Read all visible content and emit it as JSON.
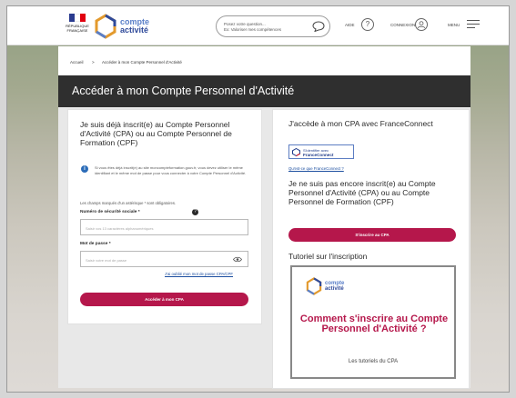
{
  "header": {
    "gov_label": "RÉPUBLIQUE FRANÇAISE",
    "logo_line1": "compte",
    "logo_line2": "activité",
    "search_placeholder_line1": "Posez votre question...",
    "search_placeholder_line2": "Ex: Valoriser mes compétences",
    "help_label": "AIDE",
    "login_label": "CONNEXION",
    "menu_label": "MENU",
    "colors": {
      "marianne_blue": "#2a3b8f",
      "marianne_red": "#e1000f"
    }
  },
  "breadcrumb": {
    "home": "Accueil",
    "separator": ">",
    "current": "Accéder à mon Compte Personnel d'Activité"
  },
  "page_title": "Accéder à mon Compte Personnel d'Activité",
  "left_card": {
    "title": "Je suis déjà inscrit(e) au Compte Personnel d'Activité (CPA) ou au Compte Personnel de Formation (CPF)",
    "info": "Si vous êtes déjà inscrit(e) au site moncompteformation.gouv.fr, vous devez utiliser le même identifiant et le même mot de passe pour vous connecter à votre Compte Personnel d'Activité.",
    "required_note": "Les champs marqués d'un astérisque * sont obligatoires.",
    "ssn_label": "Numéro de sécurité sociale *",
    "ssn_placeholder": "Saisir vos 13 caractères alphanumériques",
    "password_label": "Mot de passe *",
    "password_placeholder": "Saisir votre mot de passe",
    "forgot_link": "J'ai oublié mon mot de passe CPA/CPF",
    "submit_label": "Accéder à mon CPA",
    "accent_color": "#b5174b"
  },
  "right_card": {
    "title": "J'accède à mon CPA avec FranceConnect",
    "fc_line1": "S'identifier avec",
    "fc_line2": "FranceConnect",
    "fc_link": "Qu'est-ce que FranceConnect ?",
    "not_registered": "Je ne suis pas encore inscrit(e) au Compte Personnel d'Activité (CPA) ou au Compte Personnel de Formation (CPF)",
    "register_label": "S'inscrire au CPA",
    "tutorial_title": "Tutoriel sur l'inscription",
    "video_logo_line1": "compte",
    "video_logo_line2": "activité",
    "video_heading": "Comment s'inscrire au Compte Personnel d'Activité ?",
    "video_sub": "Les tutoriels du CPA"
  }
}
